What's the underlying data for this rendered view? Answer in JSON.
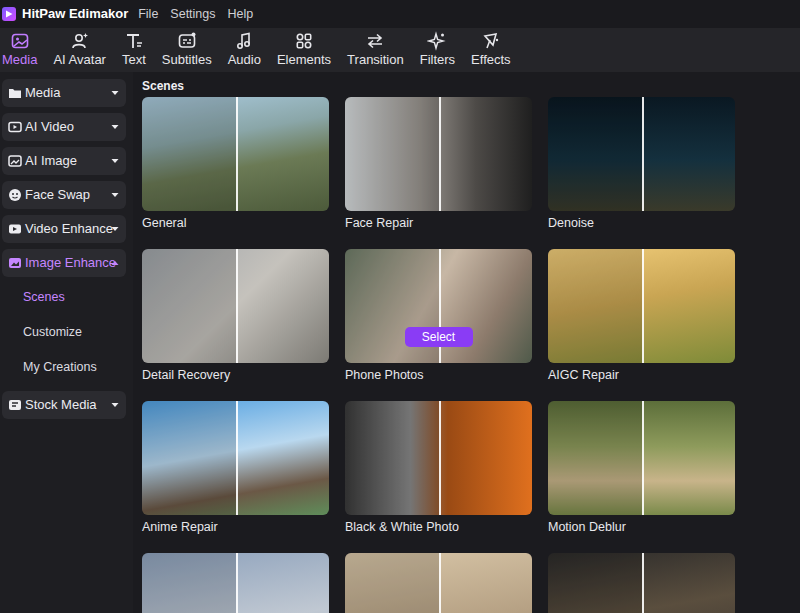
{
  "app": {
    "title": "HitPaw Edimakor",
    "menu": [
      "File",
      "Settings",
      "Help"
    ]
  },
  "toolbar": [
    {
      "label": "Media",
      "selected": true
    },
    {
      "label": "AI Avatar",
      "selected": false
    },
    {
      "label": "Text",
      "selected": false
    },
    {
      "label": "Subtitles",
      "selected": false
    },
    {
      "label": "Audio",
      "selected": false
    },
    {
      "label": "Elements",
      "selected": false
    },
    {
      "label": "Transition",
      "selected": false
    },
    {
      "label": "Filters",
      "selected": false
    },
    {
      "label": "Effects",
      "selected": false
    }
  ],
  "sidebar": {
    "items": [
      {
        "label": "Media",
        "expanded": false,
        "selected": false,
        "children": []
      },
      {
        "label": "AI Video",
        "expanded": false,
        "selected": false,
        "children": []
      },
      {
        "label": "AI Image",
        "expanded": false,
        "selected": false,
        "children": []
      },
      {
        "label": "Face Swap",
        "expanded": false,
        "selected": false,
        "children": []
      },
      {
        "label": "Video Enhance",
        "expanded": false,
        "selected": false,
        "children": []
      },
      {
        "label": "Image Enhance",
        "expanded": true,
        "selected": true,
        "children": [
          {
            "label": "Scenes",
            "selected": true
          },
          {
            "label": "Customize",
            "selected": false
          },
          {
            "label": "My Creations",
            "selected": false
          }
        ]
      },
      {
        "label": "Stock Media",
        "expanded": false,
        "selected": false,
        "children": []
      }
    ]
  },
  "scenes": {
    "title": "Scenes",
    "hover_action": "Select",
    "cards": [
      {
        "label": "General",
        "hovered": false
      },
      {
        "label": "Face Repair",
        "hovered": false
      },
      {
        "label": "Denoise",
        "hovered": false
      },
      {
        "label": "Detail Recovery",
        "hovered": false
      },
      {
        "label": "Phone Photos",
        "hovered": true
      },
      {
        "label": "AIGC Repair",
        "hovered": false
      },
      {
        "label": "Anime Repair",
        "hovered": false
      },
      {
        "label": "Black & White Photo",
        "hovered": false
      },
      {
        "label": "Motion Deblur",
        "hovered": false
      },
      {
        "label": "",
        "hovered": false
      },
      {
        "label": "",
        "hovered": false
      },
      {
        "label": "",
        "hovered": false
      }
    ]
  }
}
